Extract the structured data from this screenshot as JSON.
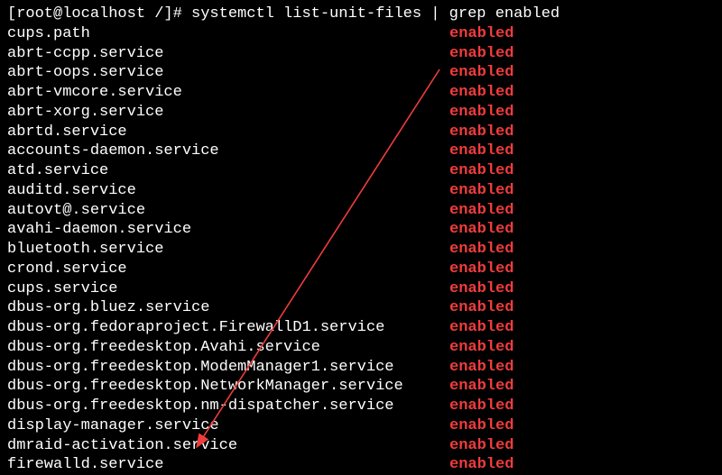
{
  "prompt": "[root@localhost /]# systemctl list-unit-files | grep enabled",
  "state_label": "enabled",
  "units": [
    "cups.path",
    "abrt-ccpp.service",
    "abrt-oops.service",
    "abrt-vmcore.service",
    "abrt-xorg.service",
    "abrtd.service",
    "accounts-daemon.service",
    "atd.service",
    "auditd.service",
    "autovt@.service",
    "avahi-daemon.service",
    "bluetooth.service",
    "crond.service",
    "cups.service",
    "dbus-org.bluez.service",
    "dbus-org.fedoraproject.FirewallD1.service",
    "dbus-org.freedesktop.Avahi.service",
    "dbus-org.freedesktop.ModemManager1.service",
    "dbus-org.freedesktop.NetworkManager.service",
    "dbus-org.freedesktop.nm-dispatcher.service",
    "display-manager.service",
    "dmraid-activation.service",
    "firewalld.service"
  ]
}
